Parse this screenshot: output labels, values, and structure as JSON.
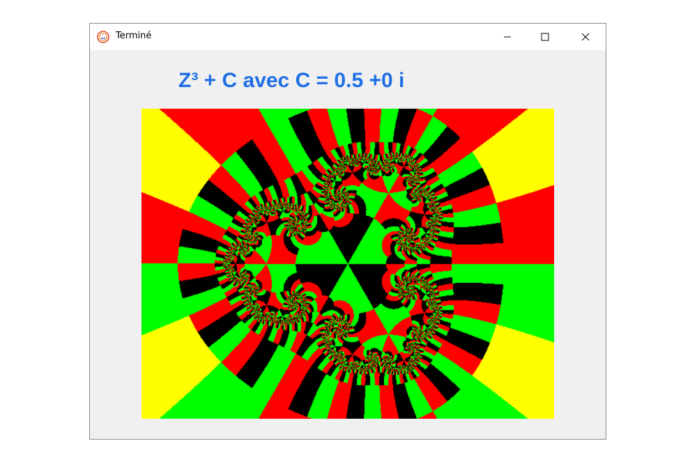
{
  "window": {
    "title": "Terminé",
    "icon": "app-logo-icon",
    "controls": [
      "minimize-icon",
      "maximize-icon",
      "close-icon"
    ]
  },
  "canvas": {
    "heading": "Z³ + C avec C = 0.5 +0 i",
    "heading_color": "#1f6fe5"
  },
  "fractal": {
    "type": "Julia set",
    "palette": {
      "background": "#000000",
      "red": "#ff0000",
      "green": "#00ff00",
      "yellow": "#ffff00"
    }
  }
}
